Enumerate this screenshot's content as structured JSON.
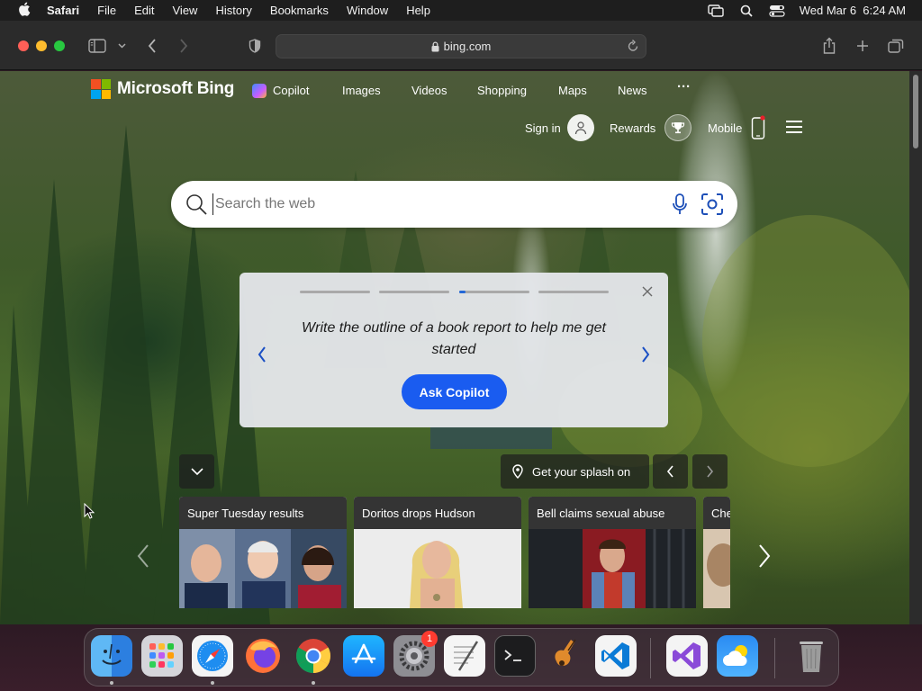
{
  "menubar": {
    "app_name": "Safari",
    "items": [
      "File",
      "Edit",
      "View",
      "History",
      "Bookmarks",
      "Window",
      "Help"
    ],
    "clock": "Wed Mar 6  6:24 AM"
  },
  "browser": {
    "url": "bing.com"
  },
  "bing": {
    "brand": "Microsoft Bing",
    "nav": {
      "copilot": "Copilot",
      "images": "Images",
      "videos": "Videos",
      "shopping": "Shopping",
      "maps": "Maps",
      "news": "News",
      "more": "···"
    },
    "account": {
      "sign_in": "Sign in",
      "rewards": "Rewards",
      "mobile": "Mobile"
    },
    "search": {
      "placeholder": "Search the web"
    },
    "promo": {
      "prompt": "Write the outline of a book report to help me get started",
      "button": "Ask Copilot"
    },
    "splash": "Get your splash on",
    "news_cards": [
      {
        "title": "Super Tuesday results"
      },
      {
        "title": "Doritos drops Hudson"
      },
      {
        "title": "Bell claims sexual abuse"
      },
      {
        "title": "Che"
      }
    ]
  },
  "dock": {
    "settings_badge": "1"
  },
  "colors": {
    "ms_red": "#f25022",
    "ms_green": "#7fba00",
    "ms_blue": "#00a4ef",
    "ms_yellow": "#ffb900",
    "copilot_button": "#1a5cf0",
    "progress_active": "#2368d8"
  }
}
